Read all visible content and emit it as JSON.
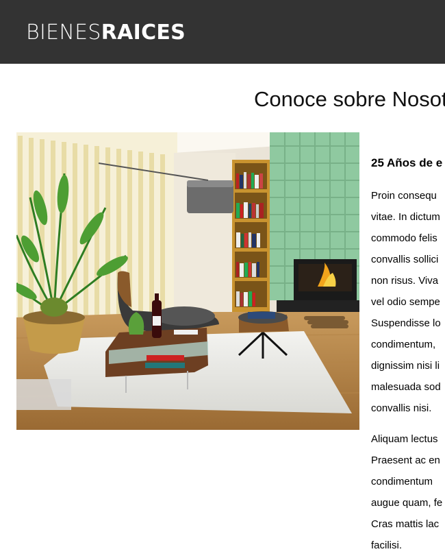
{
  "header": {
    "logo_light": "BIENES",
    "logo_bold": "RAICES"
  },
  "page": {
    "title": "Conoce sobre Nosot"
  },
  "about": {
    "subtitle": "25 Años de e",
    "paragraph1": [
      "Proin consequ",
      "vitae. In dictum",
      "commodo felis",
      "convallis sollici",
      "non risus. Viva",
      "vel odio sempe",
      "Suspendisse lo",
      "condimentum,",
      "dignissim nisi li",
      "malesuada sod",
      "convallis nisi."
    ],
    "paragraph2": [
      "Aliquam lectus",
      "Praesent ac en",
      "condimentum",
      "augue quam, fe",
      "Cras mattis lac",
      "facilisi."
    ]
  },
  "colors": {
    "header_bg": "#333333",
    "logo_text": "#ffffff",
    "accent_wall": "#8fc9a0"
  }
}
